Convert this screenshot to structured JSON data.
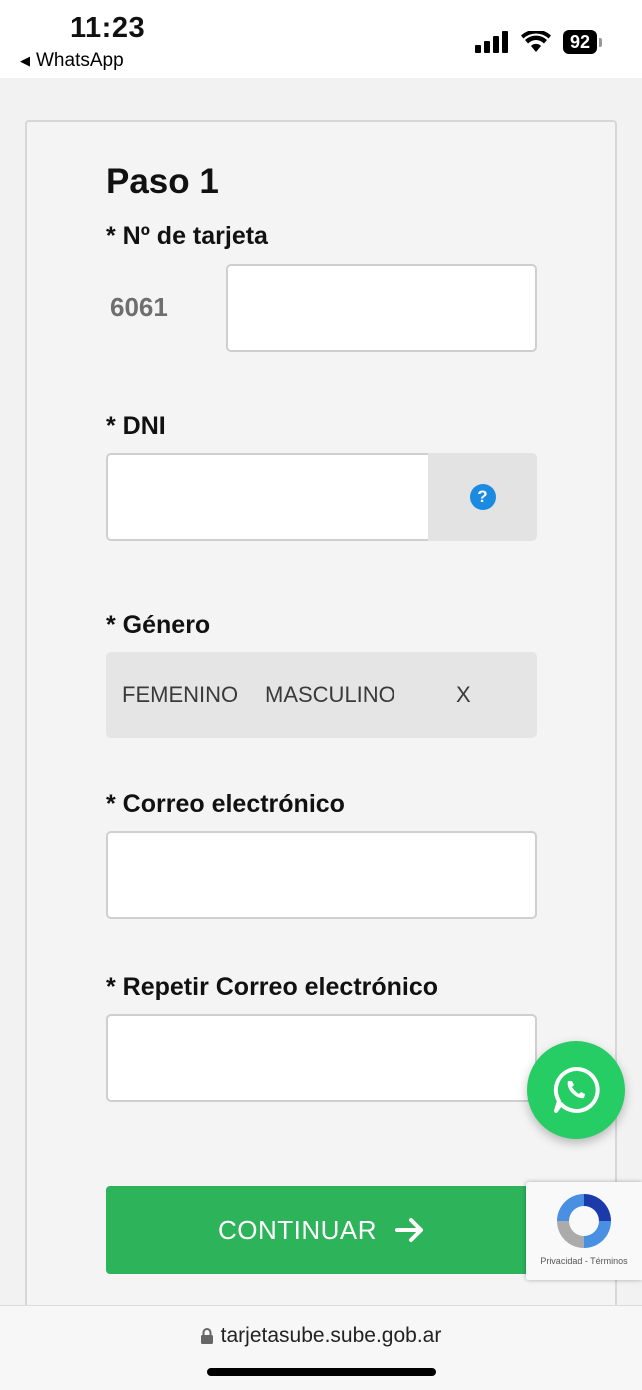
{
  "status_bar": {
    "time": "11:23",
    "back_app": "WhatsApp",
    "battery": "92"
  },
  "form": {
    "title": "Paso 1",
    "card_label": "* Nº de tarjeta",
    "card_prefix": "6061",
    "card_value": "",
    "dni_label": "* DNI",
    "dni_value": "",
    "help_icon": "?",
    "gender_label": "* Género",
    "gender_options": [
      "FEMENINO",
      "MASCULINO",
      "X"
    ],
    "email_label": "* Correo electrónico",
    "email_value": "",
    "email_repeat_label": "* Repetir Correo electrónico",
    "email_repeat_value": "",
    "continue_label": "CONTINUAR",
    "continue_icon": "arrow-right-icon"
  },
  "recaptcha": {
    "legal": "Privacidad - Términos"
  },
  "browser": {
    "url": "tarjetasube.sube.gob.ar"
  },
  "colors": {
    "primary_green": "#2db45a",
    "whatsapp_green": "#26cc64",
    "help_blue": "#1a8be0"
  }
}
